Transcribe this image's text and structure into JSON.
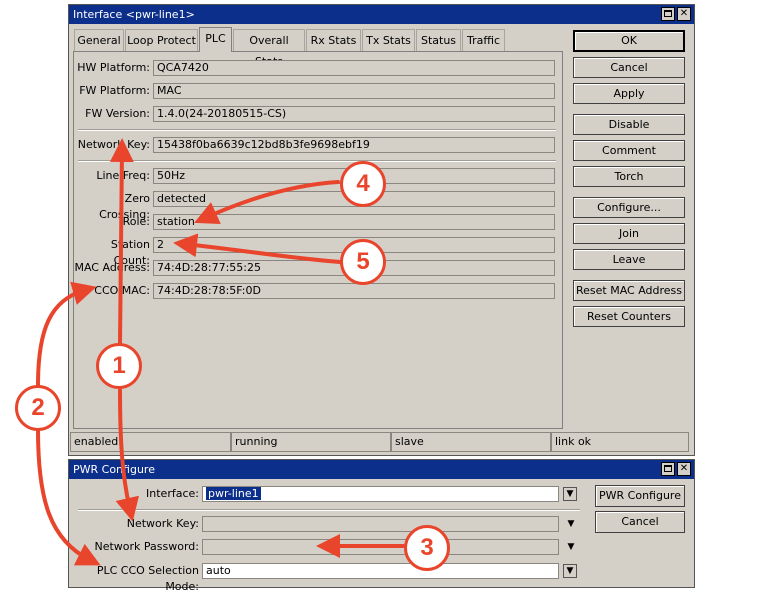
{
  "window1": {
    "title": "Interface <pwr-line1>",
    "tabs": [
      "General",
      "Loop Protect",
      "PLC",
      "Overall Stats",
      "Rx Stats",
      "Tx Stats",
      "Status",
      "Traffic"
    ],
    "fields": {
      "hw_platform": {
        "label": "HW Platform:",
        "value": "QCA7420"
      },
      "fw_platform": {
        "label": "FW Platform:",
        "value": "MAC"
      },
      "fw_version": {
        "label": "FW Version:",
        "value": "1.4.0(24-20180515-CS)"
      },
      "network_key": {
        "label": "Network Key:",
        "value": "15438f0ba6639c12bd8b3fe9698ebf19"
      },
      "line_freq": {
        "label": "Line Freq:",
        "value": "50Hz"
      },
      "zero_crossing": {
        "label": "Zero Crossing:",
        "value": "detected"
      },
      "role": {
        "label": "Role:",
        "value": "station"
      },
      "station_count": {
        "label": "Station Count:",
        "value": "2"
      },
      "mac_address": {
        "label": "MAC Address:",
        "value": "74:4D:28:77:55:25"
      },
      "cco_mac": {
        "label": "CCO MAC:",
        "value": "74:4D:28:78:5F:0D"
      }
    },
    "buttons": {
      "ok": "OK",
      "cancel": "Cancel",
      "apply": "Apply",
      "disable": "Disable",
      "comment": "Comment",
      "torch": "Torch",
      "configure": "Configure...",
      "join": "Join",
      "leave": "Leave",
      "reset_mac": "Reset MAC Address",
      "reset_counters": "Reset Counters"
    },
    "status": [
      "enabled",
      "running",
      "slave",
      "link ok"
    ]
  },
  "window2": {
    "title": "PWR Configure",
    "fields": {
      "interface": {
        "label": "Interface:",
        "value": "pwr-line1"
      },
      "network_key": {
        "label": "Network Key:",
        "value": ""
      },
      "network_password": {
        "label": "Network Password:",
        "value": ""
      },
      "cco_mode": {
        "label": "PLC CCO Selection Mode:",
        "value": "auto"
      }
    },
    "buttons": {
      "configure": "PWR Configure",
      "cancel": "Cancel"
    }
  },
  "annotations": [
    "1",
    "2",
    "3",
    "4",
    "5"
  ],
  "colors": {
    "annotation": "#e8452c",
    "titlebar": "#0d2f8c",
    "selection": "#0d2f8c"
  }
}
